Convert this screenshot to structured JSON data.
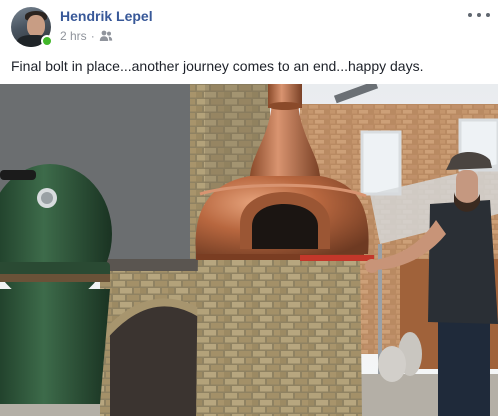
{
  "post": {
    "author": "Hendrik Lepel",
    "time": "2 hrs",
    "separator": "·",
    "audience_icon": "friends-icon",
    "more_icon": "more-options-icon",
    "text": "Final bolt in place...another journey comes to an end...happy days."
  },
  "colors": {
    "author_link": "#385898",
    "meta_text": "#90949c",
    "online": "#42b72a",
    "copper": "#b8673f"
  }
}
